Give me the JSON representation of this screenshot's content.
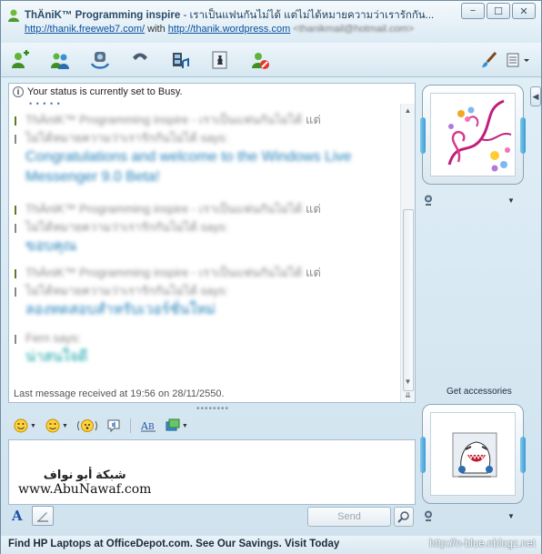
{
  "window": {
    "title_name": "ThÄniK™ Programming inspire",
    "title_status": " - เราเป็นแฟนกันไม่ได้ แต่ไม่ได้หมายความว่าเรารักกัน...",
    "sub_prefix": "",
    "link1": "http://thanik.freeweb7.com/",
    "sub_with": " with ",
    "link2": "http://thanik.wordpress.com",
    "email": " <thanikmail@hotmail.com>",
    "minimize": "−",
    "maximize": "☐",
    "close": "✕"
  },
  "toolbar": {
    "icons": [
      "invite-contact-icon",
      "share-contacts-icon",
      "video-call-icon",
      "voice-call-icon",
      "share-video-icon",
      "games-icon",
      "block-contact-icon",
      "brush-icon",
      "show-menu-icon"
    ]
  },
  "chat": {
    "status_text": "Your status is currently set to Busy.",
    "dots": "• • • • •",
    "messages": [
      {
        "sender_blur": "ThÄniK™ Programming inspire - เราเป็นแฟนกันไม่ได้",
        "sender_end": " แต่",
        "sender_line2": "ไม่ได้หมายความว่าเรารักกันไม่ได้",
        "says": " says:",
        "text": "Congratulations and welcome to the Windows Live Messenger 9.0 Beta!",
        "color": "blue"
      },
      {
        "sender_blur": "ThÄniK™ Programming inspire - เราเป็นแฟนกันไม่ได้",
        "sender_end": " แต่",
        "sender_line2": "ไม่ได้หมายความว่าเรารักกันไม่ได้",
        "says": " says:",
        "text": "ขอบคุณ",
        "color": "blue"
      },
      {
        "sender_blur": "ThÄniK™ Programming inspire - เราเป็นแฟนกันไม่ได้",
        "sender_end": " แต่",
        "sender_line2": "ไม่ได้หมายความว่าเรารักกันไม่ได้",
        "says": " says:",
        "text": "ลองทดสอบสำหรับเวอร์ชั่นใหม่",
        "color": "blue"
      },
      {
        "sender_blur": "Fern",
        "sender_end": "",
        "sender_line2": "",
        "says": " says:",
        "text": "น่าสนใจดี",
        "color": "teal"
      }
    ],
    "last_message": "Last message received at 19:56 on 28/11/2550."
  },
  "formatting": {
    "emoticon_icon": "smiley-icon",
    "wink_icon": "wink-icon",
    "nudge_icon": "nudge-icon",
    "voice_clip_icon": "voice-clip-icon",
    "font_icon": "font-style-icon",
    "background_icon": "background-icon"
  },
  "input": {
    "watermark_arabic": "شبكة أبو نواف",
    "watermark_url": "www.AbuNawaf.com",
    "font_button": "A",
    "send_label": "Send"
  },
  "sidebar": {
    "accessories_label": "Get accessories"
  },
  "ad": {
    "text": "Find HP Laptops at OfficeDepot.com. See Our Savings. Visit Today",
    "url_watermark": "http://n-blue.nblogz.net"
  },
  "colors": {
    "link": "#0a50a1",
    "message_blue": "#1f7fb8",
    "message_teal": "#0ea0a6",
    "frame": "#8aa4b8"
  }
}
